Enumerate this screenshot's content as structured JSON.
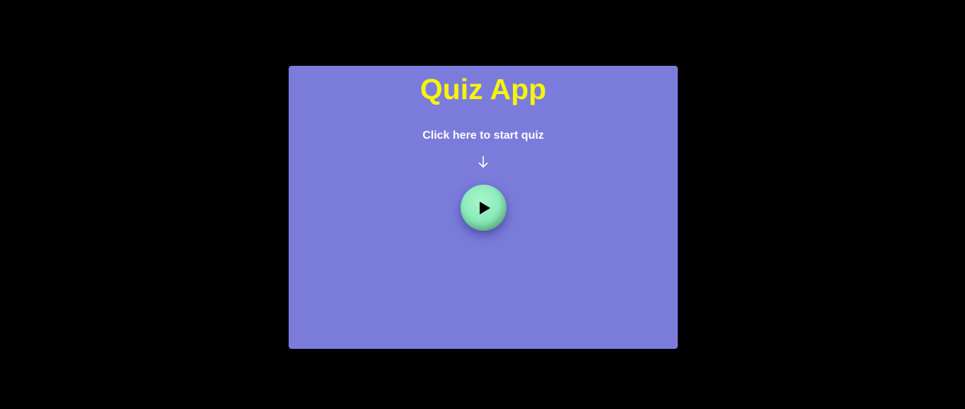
{
  "app": {
    "title": "Quiz App",
    "start_prompt": "Click here to start quiz",
    "arrow_icon": "arrow-down-icon",
    "play_icon": "play-icon",
    "colors": {
      "page_background": "#000000",
      "card_background": "#7b7bdc",
      "title_color": "#f5f50a",
      "text_color": "#ffffff",
      "button_color": "#8eecbc"
    }
  }
}
